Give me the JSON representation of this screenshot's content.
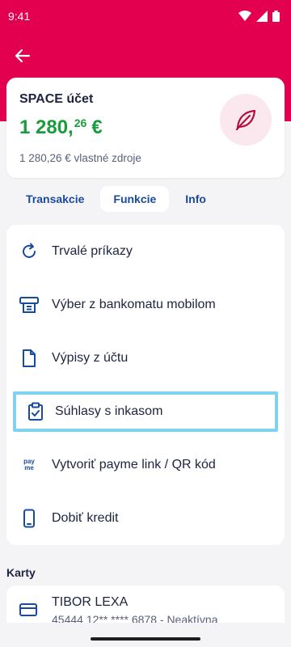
{
  "status_bar": {
    "time": "9:41"
  },
  "account": {
    "name": "SPACE účet",
    "balance_whole": "1 280,",
    "balance_cents": "26",
    "balance_currency": "€",
    "own_funds": "1 280,26 € vlastné zdroje",
    "icon": "leaf-icon"
  },
  "tabs": [
    {
      "label": "Transakcie",
      "active": false
    },
    {
      "label": "Funkcie",
      "active": true
    },
    {
      "label": "Info",
      "active": false
    }
  ],
  "functions": [
    {
      "label": "Trvalé príkazy",
      "icon": "refresh-icon"
    },
    {
      "label": "Výber z bankomatu mobilom",
      "icon": "atm-icon"
    },
    {
      "label": "Výpisy z účtu",
      "icon": "document-icon"
    },
    {
      "label": "Súhlasy s inkasom",
      "icon": "clipboard-check-icon"
    },
    {
      "label": "Vytvoriť payme link / QR kód",
      "icon": "payme-icon",
      "icon_text_top": "pay",
      "icon_text_bottom": "me"
    },
    {
      "label": "Dobiť kredit",
      "icon": "phone-icon"
    }
  ],
  "cards_section": {
    "title": "Karty",
    "cards": [
      {
        "holder": "TIBOR LEXA",
        "number": "45444 12** **** 6878 - Neaktívna"
      }
    ]
  },
  "colors": {
    "brand": "#e3004f",
    "balance": "#1a9c3c",
    "link": "#1a4a9c",
    "highlight": "#7fd3f0"
  }
}
